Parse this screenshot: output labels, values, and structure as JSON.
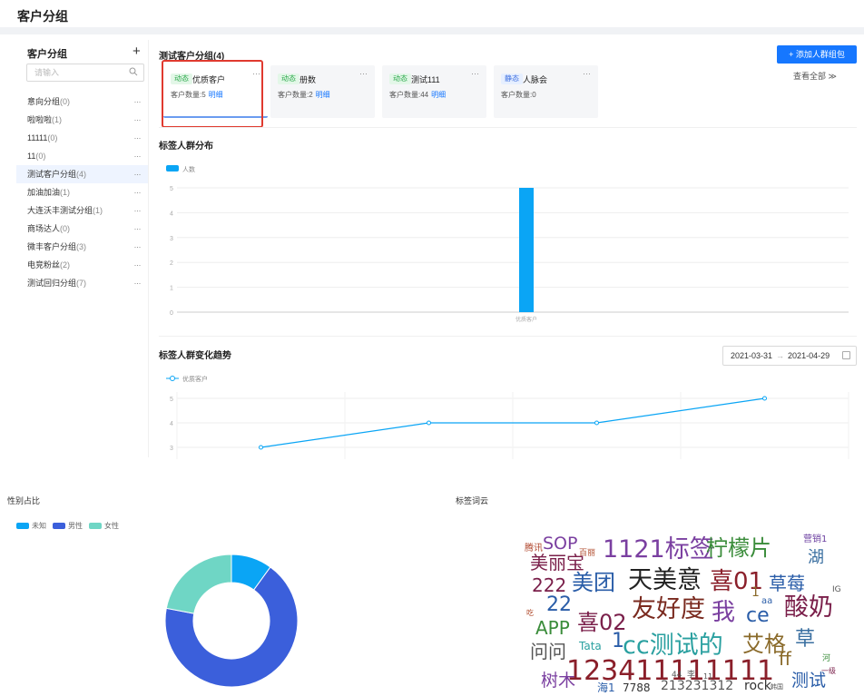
{
  "page": {
    "title": "客户分组"
  },
  "sidebar": {
    "title": "客户分组",
    "add_icon": "plus-icon",
    "search": {
      "placeholder": "请输入",
      "icon": "search-icon"
    },
    "items": [
      {
        "label": "意向分组",
        "count": "(0)",
        "more": "···"
      },
      {
        "label": "啦啦啦",
        "count": "(1)",
        "more": "···"
      },
      {
        "label": "11111",
        "count": "(0)",
        "more": "···"
      },
      {
        "label": "11",
        "count": "(0)",
        "more": "···"
      },
      {
        "label": "测试客户分组",
        "count": "(4)",
        "more": "···",
        "active": true
      },
      {
        "label": "加油加油",
        "count": "(1)",
        "more": "···"
      },
      {
        "label": "大连沃丰测试分组",
        "count": "(1)",
        "more": "···"
      },
      {
        "label": "商场达人",
        "count": "(0)",
        "more": "···"
      },
      {
        "label": "微丰客户分组",
        "count": "(3)",
        "more": "···"
      },
      {
        "label": "电竞粉丝",
        "count": "(2)",
        "more": "···"
      },
      {
        "label": "测试回归分组",
        "count": "(7)",
        "more": "···"
      }
    ]
  },
  "main": {
    "title": "测试客户分组(4)",
    "add_button": "+ 添加人群组包",
    "view_all": "查看全部 ≫",
    "cards": [
      {
        "tag": "动态",
        "tag_type": "dyn",
        "name": "优质客户",
        "count_label": "客户数量:5",
        "link": "明细",
        "more": "···"
      },
      {
        "tag": "动态",
        "tag_type": "dyn",
        "name": "册数",
        "count_label": "客户数量:2",
        "link": "明细",
        "more": "···"
      },
      {
        "tag": "动态",
        "tag_type": "dyn",
        "name": "测试111",
        "count_label": "客户数量:44",
        "link": "明细",
        "more": "···"
      },
      {
        "tag": "静态",
        "tag_type": "stat",
        "name": "人脉会",
        "count_label": "客户数量:0",
        "link": "",
        "more": "···"
      }
    ]
  },
  "distribution": {
    "title": "标签人群分布"
  },
  "trend": {
    "title": "标签人群变化趋势",
    "date_start": "2021-03-31",
    "date_sep": "→",
    "date_end": "2021-04-29"
  },
  "gender": {
    "title": "性别占比"
  },
  "wordcloud": {
    "title": "标签词云",
    "words": [
      {
        "t": "腾讯",
        "c": "#b0462c",
        "s": 10
      },
      {
        "t": "SOP",
        "c": "#7a3fa0",
        "s": 19
      },
      {
        "t": "1121标签",
        "c": "#7a3fa0",
        "s": 27
      },
      {
        "t": "柠檬片",
        "c": "#3a8c3a",
        "s": 24
      },
      {
        "t": "营销1",
        "c": "#6b3fa0",
        "s": 10
      },
      {
        "t": "美丽宝",
        "c": "#7a1f4a",
        "s": 20
      },
      {
        "t": "百丽",
        "c": "#b04b2c",
        "s": 9
      },
      {
        "t": "湖",
        "c": "#3a6fa0",
        "s": 18
      },
      {
        "t": "222",
        "c": "#7a1f4a",
        "s": 20
      },
      {
        "t": "美团",
        "c": "#2a5da8",
        "s": 24
      },
      {
        "t": "天美意",
        "c": "#222222",
        "s": 27
      },
      {
        "t": "喜01",
        "c": "#8a1f2a",
        "s": 26
      },
      {
        "t": "草莓",
        "c": "#2a5da8",
        "s": 20
      },
      {
        "t": "IG",
        "c": "#555555",
        "s": 9
      },
      {
        "t": "吃",
        "c": "#b04b2c",
        "s": 8
      },
      {
        "t": "22",
        "c": "#2a5da8",
        "s": 22
      },
      {
        "t": "1",
        "c": "#8a6a2a",
        "s": 14
      },
      {
        "t": "aa",
        "c": "#2a5da8",
        "s": 10
      },
      {
        "t": "喜02",
        "c": "#7a1f4a",
        "s": 24
      },
      {
        "t": "友好度",
        "c": "#7a2a1f",
        "s": 27
      },
      {
        "t": "我",
        "c": "#7a3fa0",
        "s": 26
      },
      {
        "t": "ce",
        "c": "#2a5da8",
        "s": 22
      },
      {
        "t": "酸奶",
        "c": "#7a1f4a",
        "s": 27
      },
      {
        "t": "APP",
        "c": "#3a8c3a",
        "s": 20
      },
      {
        "t": "Tata",
        "c": "#2aa0a0",
        "s": 12
      },
      {
        "t": "1",
        "c": "#2a5da8",
        "s": 22
      },
      {
        "t": "cc测试的",
        "c": "#2aa0a0",
        "s": 27
      },
      {
        "t": "艾格",
        "c": "#8a6a2a",
        "s": 24
      },
      {
        "t": "草",
        "c": "#3a6fa0",
        "s": 22
      },
      {
        "t": "河",
        "c": "#3a8c3a",
        "s": 9
      },
      {
        "t": "问问",
        "c": "#555555",
        "s": 20
      },
      {
        "t": "一级",
        "c": "#7a1f4a",
        "s": 8
      },
      {
        "t": "123411111111",
        "c": "#8a1f2a",
        "s": 30
      },
      {
        "t": "44",
        "c": "#555555",
        "s": 9
      },
      {
        "t": "李",
        "c": "#555555",
        "s": 9
      },
      {
        "t": "11",
        "c": "#555555",
        "s": 8
      },
      {
        "t": "ff",
        "c": "#8a6a2a",
        "s": 20
      },
      {
        "t": "树木",
        "c": "#7a3fa0",
        "s": 19
      },
      {
        "t": "海1",
        "c": "#2a5da8",
        "s": 12
      },
      {
        "t": "7788",
        "c": "#333333",
        "s": 12
      },
      {
        "t": "213231312",
        "c": "#555555",
        "s": 14
      },
      {
        "t": "rock",
        "c": "#333333",
        "s": 14
      },
      {
        "t": "韩国",
        "c": "#555555",
        "s": 7
      },
      {
        "t": "测试",
        "c": "#2a5da8",
        "s": 19
      }
    ]
  },
  "chart_data": [
    {
      "type": "bar",
      "title": "标签人群分布",
      "legend": [
        "人数"
      ],
      "categories": [
        "优质客户"
      ],
      "series": [
        {
          "name": "人数",
          "values": [
            5
          ],
          "color": "#0aa5f5"
        }
      ],
      "ylim": [
        0,
        5
      ],
      "yticks": [
        0,
        1,
        2,
        3,
        4,
        5
      ],
      "grid": true,
      "legend_position": "top-left"
    },
    {
      "type": "line",
      "title": "标签人群变化趋势",
      "legend": [
        "优质客户"
      ],
      "series": [
        {
          "name": "优质客户",
          "values": [
            3,
            4,
            4,
            5
          ],
          "color": "#0aa5f5"
        }
      ],
      "yticks_visible": [
        3,
        4,
        5
      ],
      "grid": true,
      "legend_position": "top-left"
    },
    {
      "type": "pie",
      "title": "性别占比",
      "legend": [
        "未知",
        "男性",
        "女性"
      ],
      "slices": [
        {
          "name": "未知",
          "value": 10,
          "color": "#0aa5f5"
        },
        {
          "name": "男性",
          "value": 68,
          "color": "#3b5fdb"
        },
        {
          "name": "女性",
          "value": 22,
          "color": "#6fd6c5"
        }
      ],
      "donut": true,
      "legend_position": "top-left"
    }
  ]
}
